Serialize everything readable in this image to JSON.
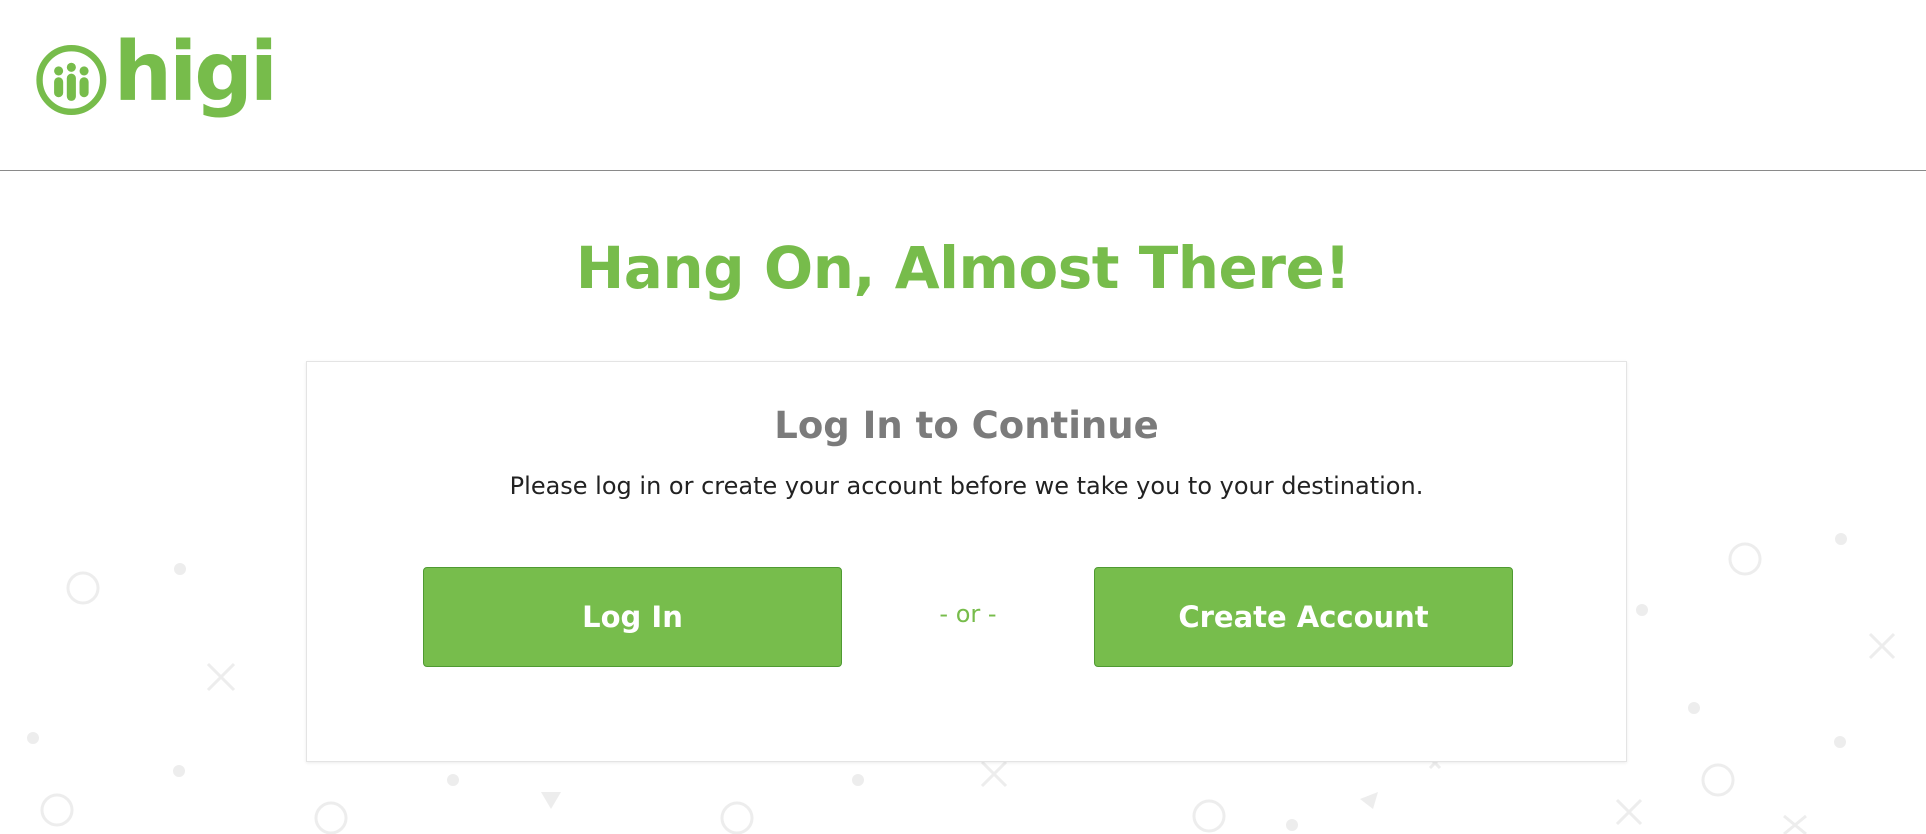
{
  "header": {
    "logo_text": "higi",
    "logo_icon": "higi-people-icon"
  },
  "main": {
    "title": "Hang On, Almost There!"
  },
  "card": {
    "title": "Log In to Continue",
    "description": "Please log in or create your account before we take you to your destination.",
    "login_label": "Log In",
    "or_label": "- or -",
    "create_label": "Create Account"
  },
  "colors": {
    "brand_green": "#77bc4b",
    "button_green": "#77bd4c",
    "title_gray": "#7b7b7b",
    "text_dark": "#222222",
    "divider": "#8a8a8a",
    "decoration": "#ededed"
  }
}
